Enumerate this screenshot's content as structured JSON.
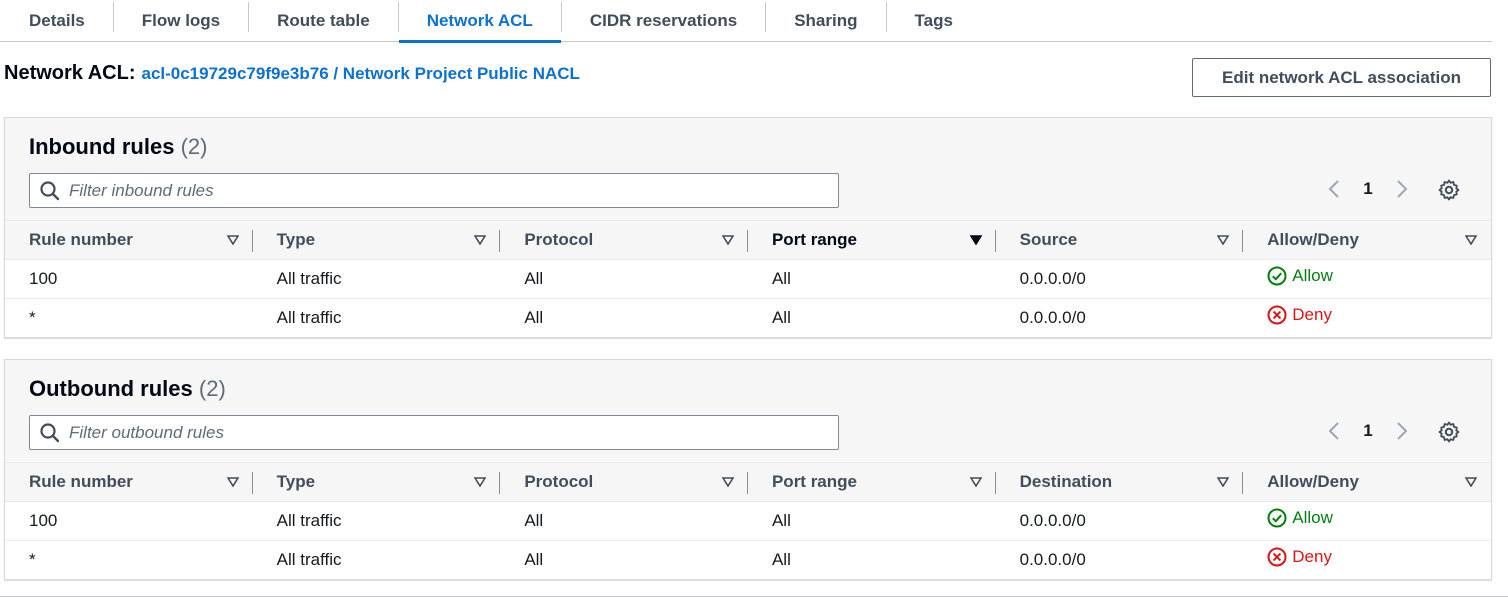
{
  "tabs": [
    {
      "label": "Details",
      "active": false
    },
    {
      "label": "Flow logs",
      "active": false
    },
    {
      "label": "Route table",
      "active": false
    },
    {
      "label": "Network ACL",
      "active": true
    },
    {
      "label": "CIDR reservations",
      "active": false
    },
    {
      "label": "Sharing",
      "active": false
    },
    {
      "label": "Tags",
      "active": false
    }
  ],
  "header": {
    "title": "Network ACL:",
    "link": "acl-0c19729c79f9e3b76 / Network Project Public NACL",
    "edit_button": "Edit network ACL association"
  },
  "inbound": {
    "title": "Inbound rules",
    "count": "(2)",
    "filter_placeholder": "Filter inbound rules",
    "page": "1",
    "columns": [
      "Rule number",
      "Type",
      "Protocol",
      "Port range",
      "Source",
      "Allow/Deny"
    ],
    "rows": [
      {
        "rule": "100",
        "type": "All traffic",
        "protocol": "All",
        "port": "All",
        "addr": "0.0.0.0/0",
        "action": "Allow"
      },
      {
        "rule": "*",
        "type": "All traffic",
        "protocol": "All",
        "port": "All",
        "addr": "0.0.0.0/0",
        "action": "Deny"
      }
    ]
  },
  "outbound": {
    "title": "Outbound rules",
    "count": "(2)",
    "filter_placeholder": "Filter outbound rules",
    "page": "1",
    "columns": [
      "Rule number",
      "Type",
      "Protocol",
      "Port range",
      "Destination",
      "Allow/Deny"
    ],
    "rows": [
      {
        "rule": "100",
        "type": "All traffic",
        "protocol": "All",
        "port": "All",
        "addr": "0.0.0.0/0",
        "action": "Allow"
      },
      {
        "rule": "*",
        "type": "All traffic",
        "protocol": "All",
        "port": "All",
        "addr": "0.0.0.0/0",
        "action": "Deny"
      }
    ]
  },
  "icons": {
    "search": "search-icon",
    "prev": "chevron-left-icon",
    "next": "chevron-right-icon",
    "settings": "gear-icon",
    "sort": "caret-down-icon",
    "allow": "check-circle-icon",
    "deny": "x-circle-icon"
  },
  "colors": {
    "accent": "#0972d3",
    "allow": "#037f0c",
    "deny": "#d91515"
  }
}
